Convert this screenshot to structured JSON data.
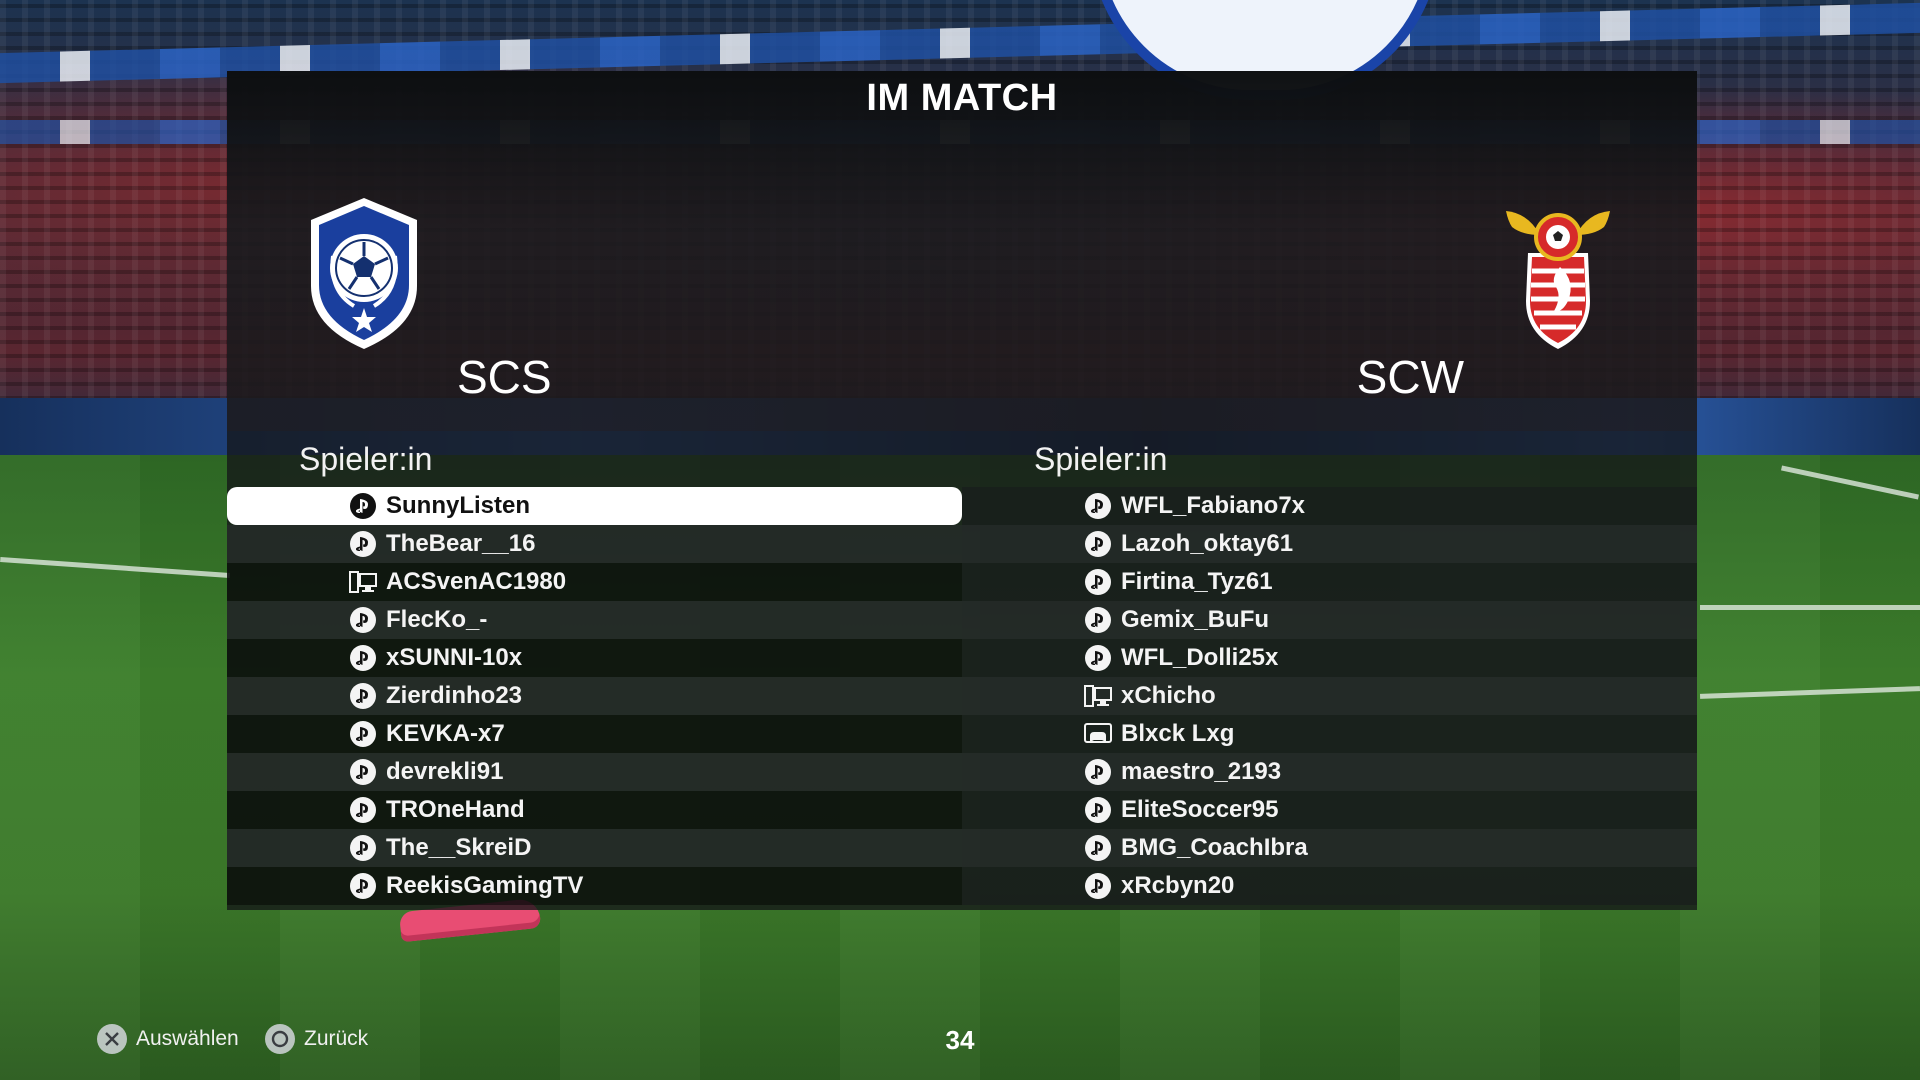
{
  "title": "IM MATCH",
  "home_team": {
    "name": "SCS",
    "column_header": "Spieler:in",
    "players": [
      {
        "name": "SunnyListen",
        "platform": "playstation-icon",
        "selected": true
      },
      {
        "name": "TheBear__16",
        "platform": "playstation-icon"
      },
      {
        "name": "ACSvenAC1980",
        "platform": "pc-icon"
      },
      {
        "name": "FlecKo_-",
        "platform": "playstation-icon"
      },
      {
        "name": "xSUNNI-10x",
        "platform": "playstation-icon"
      },
      {
        "name": "Zierdinho23",
        "platform": "playstation-icon"
      },
      {
        "name": "KEVKA-x7",
        "platform": "playstation-icon"
      },
      {
        "name": "devrekli91",
        "platform": "playstation-icon"
      },
      {
        "name": "TROneHand",
        "platform": "playstation-icon"
      },
      {
        "name": "The__SkreiD",
        "platform": "playstation-icon"
      },
      {
        "name": "ReekisGamingTV",
        "platform": "playstation-icon"
      }
    ]
  },
  "away_team": {
    "name": "SCW",
    "column_header": "Spieler:in",
    "players": [
      {
        "name": "WFL_Fabiano7x",
        "platform": "playstation-icon"
      },
      {
        "name": "Lazoh_oktay61",
        "platform": "playstation-icon"
      },
      {
        "name": "Firtina_Tyz61",
        "platform": "playstation-icon"
      },
      {
        "name": "Gemix_BuFu",
        "platform": "playstation-icon"
      },
      {
        "name": "WFL_Dolli25x",
        "platform": "playstation-icon"
      },
      {
        "name": "xChicho",
        "platform": "pc-icon"
      },
      {
        "name": "Blxck Lxg",
        "platform": "xbox-controller-icon"
      },
      {
        "name": "maestro_2193",
        "platform": "playstation-icon"
      },
      {
        "name": "EliteSoccer95",
        "platform": "playstation-icon"
      },
      {
        "name": "BMG_CoachIbra",
        "platform": "playstation-icon"
      },
      {
        "name": "xRcbyn20",
        "platform": "playstation-icon"
      }
    ]
  },
  "footer": {
    "select_label": "Auswählen",
    "back_label": "Zurück",
    "page_number": "34"
  },
  "colors": {
    "selected_row": "#ffffff",
    "home_crest_primary": "#1a3f9e",
    "away_crest_primary": "#d62a2a",
    "away_crest_wings": "#e8b820"
  }
}
